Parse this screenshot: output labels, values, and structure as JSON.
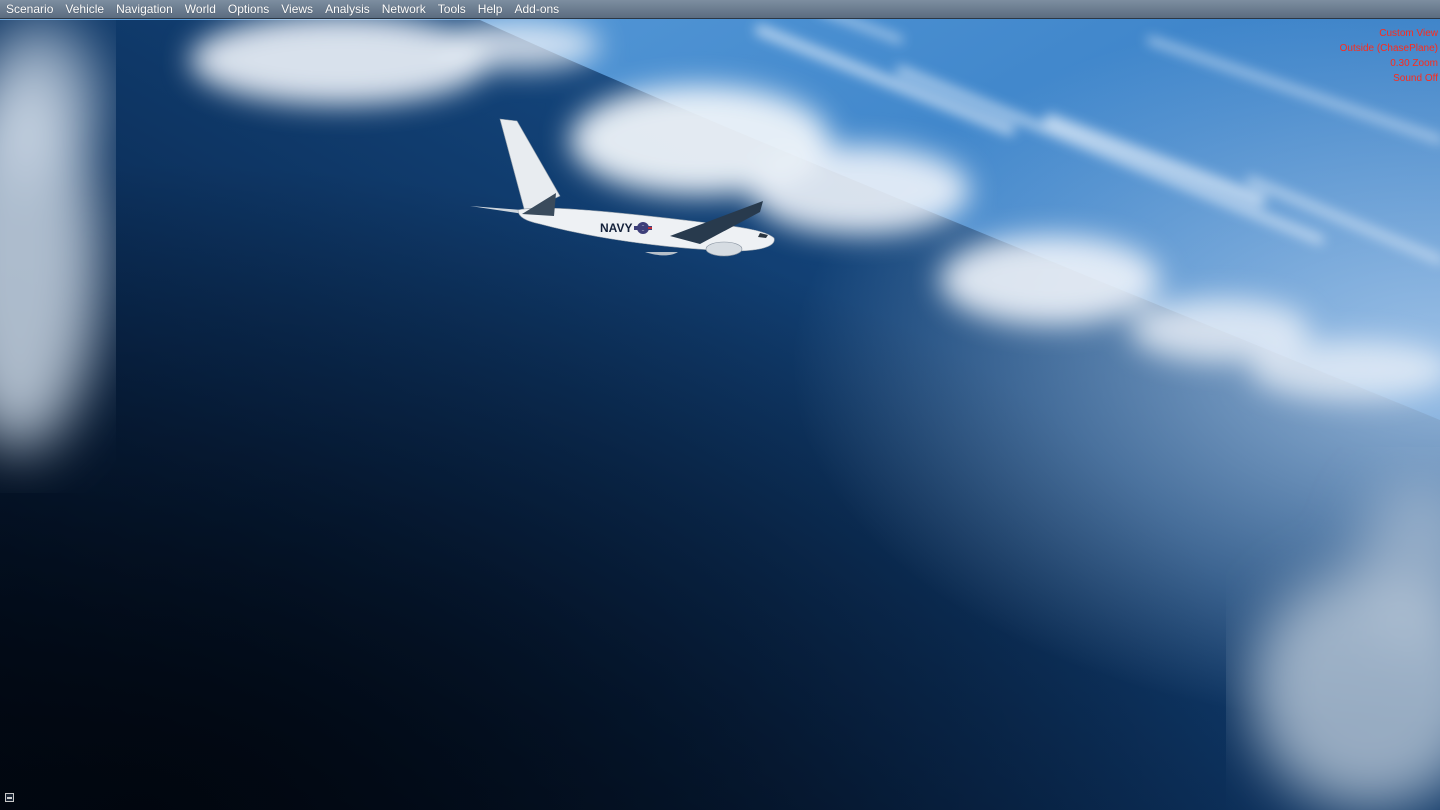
{
  "menu": {
    "items": [
      "Scenario",
      "Vehicle",
      "Navigation",
      "World",
      "Options",
      "Views",
      "Analysis",
      "Network",
      "Tools",
      "Help",
      "Add-ons"
    ]
  },
  "hud": {
    "color": "#ff2a1a",
    "lines": [
      "Custom View",
      "Outside (ChasePlane)",
      "0.30 Zoom",
      "Sound Off"
    ]
  },
  "aircraft": {
    "fuselage_text": "NAVY"
  },
  "colors": {
    "sky": "#3a7fc4",
    "ocean_deep": "#041326",
    "ocean_mid": "#0f3d70",
    "cloud": "#e9eef4",
    "menubar": "#6b7d91"
  },
  "icons": {
    "corner": "window-toggle-icon"
  }
}
